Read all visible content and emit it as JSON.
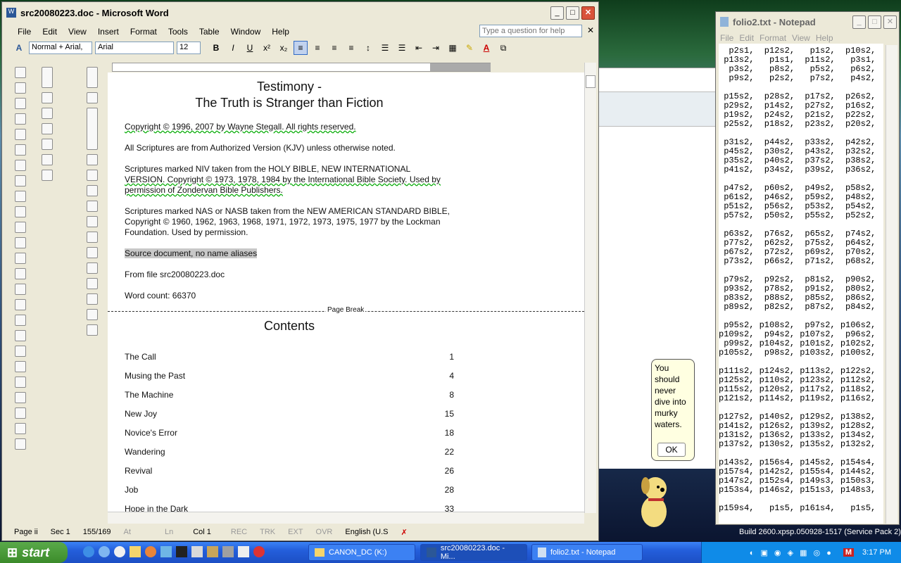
{
  "word": {
    "title": "src20080223.doc - Microsoft Word",
    "menu": [
      "File",
      "Edit",
      "View",
      "Insert",
      "Format",
      "Tools",
      "Table",
      "Window",
      "Help"
    ],
    "help_placeholder": "Type a question for help",
    "style": "Normal + Arial,",
    "font": "Arial",
    "size": "12",
    "doc": {
      "title1": "Testimony -",
      "title2": "The Truth is Stranger than Fiction",
      "copyright": "Copyright © 1996, 2007 by Wayne Stegall.  All rights reserved.",
      "kjv": "All Scriptures are from Authorized Version (KJV) unless otherwise noted.",
      "niv1": "Scriptures marked NIV taken from the HOLY BIBLE, NEW INTERNATIONAL",
      "niv2": "VERSION.  Copyright © 1973, 1978, 1984 by the International Bible Society.  Used by",
      "niv3": "permission of Zondervan Bible Publishers.",
      "nas1": "Scriptures marked NAS or NASB taken from the NEW AMERICAN STANDARD BIBLE,",
      "nas2": "Copyright © 1960, 1962, 1963, 1968, 1971, 1972, 1973, 1975, 1977 by the Lockman",
      "nas3": "Foundation. Used by permission.",
      "source": "Source document, no name aliases",
      "fromfile": "From file src20080223.doc",
      "wordcount": "Word count: 66370",
      "pagebreak": "Page Break",
      "contents": "Contents",
      "toc": [
        {
          "t": "The Call",
          "p": "1"
        },
        {
          "t": "Musing the Past",
          "p": "4"
        },
        {
          "t": "The Machine",
          "p": "8"
        },
        {
          "t": "New Joy",
          "p": "15"
        },
        {
          "t": "Novice's Error",
          "p": "18"
        },
        {
          "t": "Wandering",
          "p": "22"
        },
        {
          "t": "Revival",
          "p": "26"
        },
        {
          "t": "Job",
          "p": "28"
        },
        {
          "t": "Hope in the Dark",
          "p": "33"
        }
      ]
    },
    "status": {
      "page": "Page  ii",
      "sec": "Sec  1",
      "pages": "155/169",
      "at": "At",
      "ln": "Ln",
      "col": "Col  1",
      "rec": "REC",
      "trk": "TRK",
      "ext": "EXT",
      "ovr": "OVR",
      "lang": "English (U.S"
    }
  },
  "notepad": {
    "title": "folio2.txt - Notepad",
    "menu": [
      "File",
      "Edit",
      "Format",
      "View",
      "Help"
    ],
    "text": "  p2s1,  p12s2,   p1s2,  p10s2,\n p13s2,   p1s1,  p11s2,   p3s1,\n  p3s2,   p8s2,   p5s2,   p6s2,\n  p9s2,   p2s2,   p7s2,   p4s2,\n\n p15s2,  p28s2,  p17s2,  p26s2,\n p29s2,  p14s2,  p27s2,  p16s2,\n p19s2,  p24s2,  p21s2,  p22s2,\n p25s2,  p18s2,  p23s2,  p20s2,\n\n p31s2,  p44s2,  p33s2,  p42s2,\n p45s2,  p30s2,  p43s2,  p32s2,\n p35s2,  p40s2,  p37s2,  p38s2,\n p41s2,  p34s2,  p39s2,  p36s2,\n\n p47s2,  p60s2,  p49s2,  p58s2,\n p61s2,  p46s2,  p59s2,  p48s2,\n p51s2,  p56s2,  p53s2,  p54s2,\n p57s2,  p50s2,  p55s2,  p52s2,\n\n p63s2,  p76s2,  p65s2,  p74s2,\n p77s2,  p62s2,  p75s2,  p64s2,\n p67s2,  p72s2,  p69s2,  p70s2,\n p73s2,  p66s2,  p71s2,  p68s2,\n\n p79s2,  p92s2,  p81s2,  p90s2,\n p93s2,  p78s2,  p91s2,  p80s2,\n p83s2,  p88s2,  p85s2,  p86s2,\n p89s2,  p82s2,  p87s2,  p84s2,\n\n p95s2, p108s2,  p97s2, p106s2,\np109s2,  p94s2, p107s2,  p96s2,\n p99s2, p104s2, p101s2, p102s2,\np105s2,  p98s2, p103s2, p100s2,\n\np111s2, p124s2, p113s2, p122s2,\np125s2, p110s2, p123s2, p112s2,\np115s2, p120s2, p117s2, p118s2,\np121s2, p114s2, p119s2, p116s2,\n\np127s2, p140s2, p129s2, p138s2,\np141s2, p126s2, p139s2, p128s2,\np131s2, p136s2, p133s2, p134s2,\np137s2, p130s2, p135s2, p132s2,\n\np143s2, p156s4, p145s2, p154s4,\np157s4, p142s2, p155s4, p144s2,\np147s2, p152s4, p149s3, p150s3,\np153s4, p146s2, p151s3, p148s3,\n\np159s4,   p1s5, p161s4,   p1s5,"
  },
  "assistant": {
    "text": "You should never dive into murky waters.",
    "ok": "OK"
  },
  "desktop": {
    "build": "Build 2600.xpsp.050928-1517 (Service Pack 2)"
  },
  "taskbar": {
    "start": "start",
    "items": [
      "CANON_DC (K:)",
      "src20080223.doc - Mi...",
      "folio2.txt - Notepad"
    ],
    "clock": "3:17 PM"
  }
}
